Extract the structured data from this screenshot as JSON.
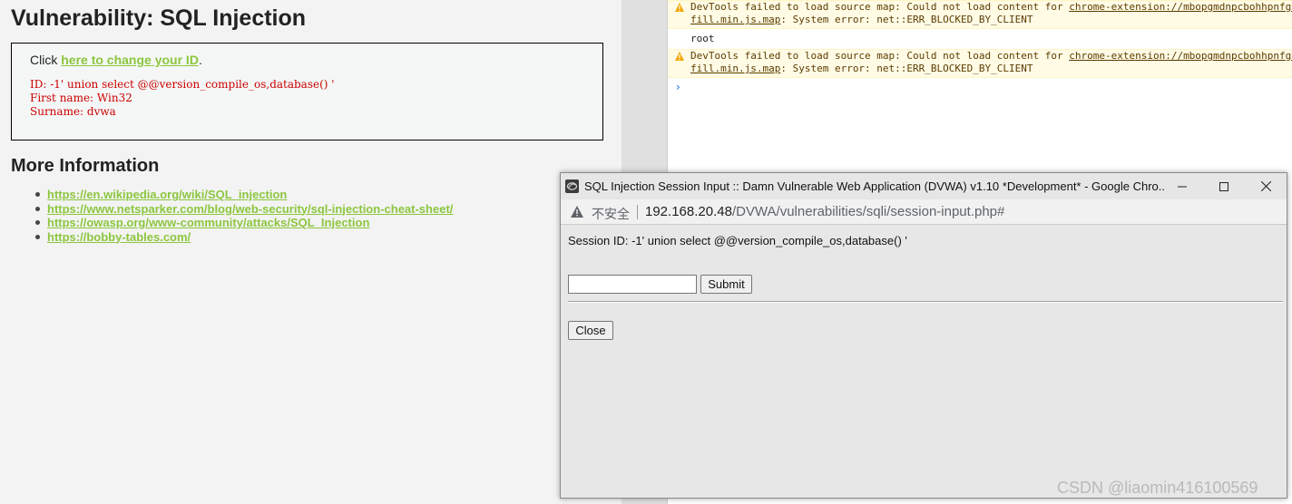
{
  "dvwa": {
    "title": "Vulnerability: SQL Injection",
    "click_prefix": "Click ",
    "change_id_link": "here to change your ID",
    "click_suffix": ".",
    "output": {
      "id_line": "ID: -1' union select @@version_compile_os,database() '",
      "first_name_line": "First name: Win32",
      "surname_line": "Surname: dvwa"
    },
    "more_info_heading": "More Information",
    "links": [
      "https://en.wikipedia.org/wiki/SQL_injection",
      "https://www.netsparker.com/blog/web-security/sql-injection-cheat-sheet/",
      "https://owasp.org/www-community/attacks/SQL_Injection",
      "https://bobby-tables.com/"
    ],
    "link_color": "#8cc63f",
    "output_color": "#cc0000"
  },
  "console": {
    "messages": [
      {
        "level": "warning",
        "line1_text": "DevTools failed to load source map: Could not load content for ",
        "line1_link": "chrome-extension://mbopgmdnpcbohhpnfgl",
        "line2_link": "fill.min.js.map",
        "line2_text": ": System error: net::ERR_BLOCKED_BY_CLIENT"
      },
      {
        "level": "log",
        "text": "root"
      },
      {
        "level": "warning",
        "line1_text": "DevTools failed to load source map: Could not load content for ",
        "line1_link": "chrome-extension://mbopgmdnpcbohhpnfgl",
        "line2_link": "fill.min.js.map",
        "line2_text": ": System error: net::ERR_BLOCKED_BY_CLIENT"
      }
    ],
    "prompt_symbol": "›"
  },
  "popup": {
    "window_title": "SQL Injection Session Input :: Damn Vulnerable Web Application (DVWA) v1.10 *Development* - Google Chro...",
    "address": {
      "insecure_label": "不安全",
      "host": "192.168.20.48",
      "path": "/DVWA/vulnerabilities/sqli/session-input.php#"
    },
    "session_line": "Session ID: -1' union select @@version_compile_os,database() '",
    "input_value": "",
    "submit_label": "Submit",
    "close_label": "Close",
    "controls": {
      "minimize_icon": "minimize-icon",
      "maximize_icon": "maximize-icon",
      "close_icon": "close-icon"
    }
  },
  "watermark": "CSDN @liaomin416100569"
}
